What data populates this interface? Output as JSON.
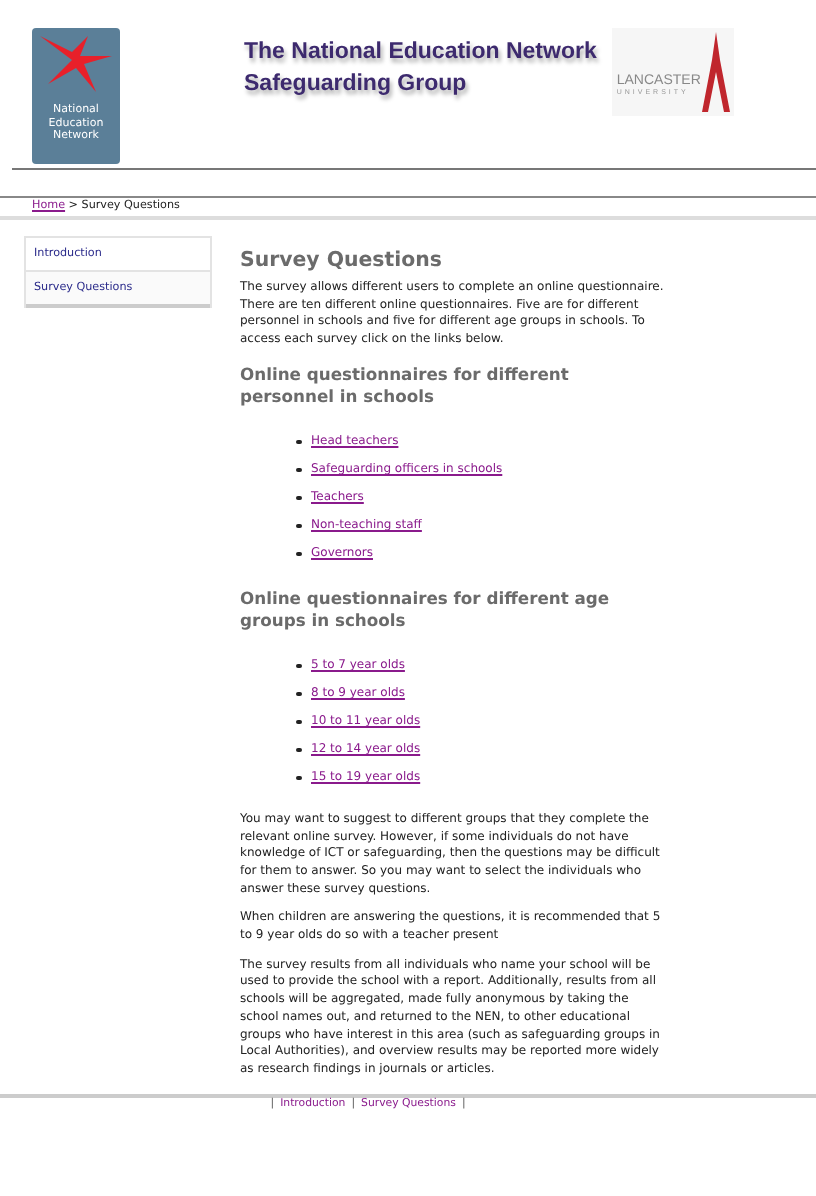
{
  "header": {
    "logo_text": [
      "National",
      "Education",
      "Network"
    ],
    "title_lines": [
      "The National Education Network",
      "Safeguarding Group"
    ],
    "partner_logo": [
      "LANCASTER",
      "UNIVERSITY"
    ]
  },
  "breadcrumb": {
    "link": "Home",
    "separator": ">",
    "current": "Survey Questions"
  },
  "sidebar": {
    "items": [
      {
        "label": "Introduction",
        "selected": false
      },
      {
        "label": "Survey Questions",
        "selected": true
      }
    ]
  },
  "main": {
    "title": "Survey Questions",
    "intro": "The survey allows different users to complete an online questionnaire. There are ten different online questionnaires. Five are for different personnel in schools and five for different age groups in schools. To access each survey click on the links below.",
    "sections": [
      {
        "heading": "Online questionnaires for different personnel in schools",
        "links": [
          "Head teachers",
          "Safeguarding officers in schools",
          "Teachers",
          "Non-teaching staff",
          "Governors"
        ]
      },
      {
        "heading": "Online questionnaires for different age groups in schools",
        "links": [
          "5 to 7 year olds",
          "8 to 9 year olds",
          "10 to 11 year olds",
          "12 to 14 year olds",
          "15 to 19 year olds"
        ]
      }
    ],
    "paragraphs": [
      "You may want to suggest to different groups that they complete the relevant online survey. However, if some individuals do not have knowledge of ICT or safeguarding, then the questions may be difficult for them to answer. So you may want to select the individuals who answer these survey questions.",
      "When children are answering the questions, it is recommended that 5 to 9 year olds do so with a teacher present",
      "The survey results from all individuals who name your school will be used to provide the school with a report. Additionally, results from all schools will be aggregated, made fully anonymous by taking the school names out, and returned to the NEN, to other educational groups who have interest in this area (such as safeguarding groups in Local Authorities), and overview results may be reported more widely as research findings in journals or articles."
    ]
  },
  "footer": {
    "separator": "|",
    "links": [
      "Introduction",
      "Survey Questions"
    ]
  }
}
